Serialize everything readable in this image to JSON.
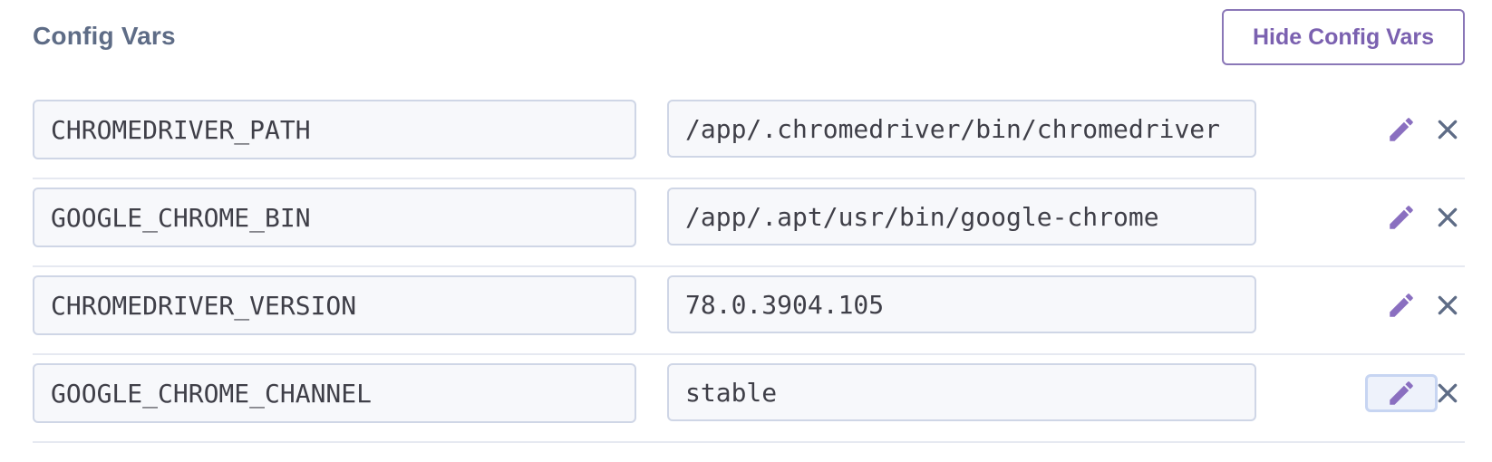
{
  "section": {
    "title": "Config Vars",
    "toggle_label": "Hide Config Vars"
  },
  "colors": {
    "title": "#5e6c86",
    "accent": "#7b61b0",
    "field_border": "#cfd6e6",
    "field_bg": "#f7f8fb",
    "delete_icon": "#5e6c86",
    "focus_ring": "#c7d5f2"
  },
  "config_vars": [
    {
      "key": "CHROMEDRIVER_PATH",
      "value": "/app/.chromedriver/bin/chromedriver"
    },
    {
      "key": "GOOGLE_CHROME_BIN",
      "value": "/app/.apt/usr/bin/google-chrome"
    },
    {
      "key": "CHROMEDRIVER_VERSION",
      "value": "78.0.3904.105"
    },
    {
      "key": "GOOGLE_CHROME_CHANNEL",
      "value": "stable"
    }
  ],
  "icons": {
    "edit": "pencil-icon",
    "delete": "close-icon"
  }
}
